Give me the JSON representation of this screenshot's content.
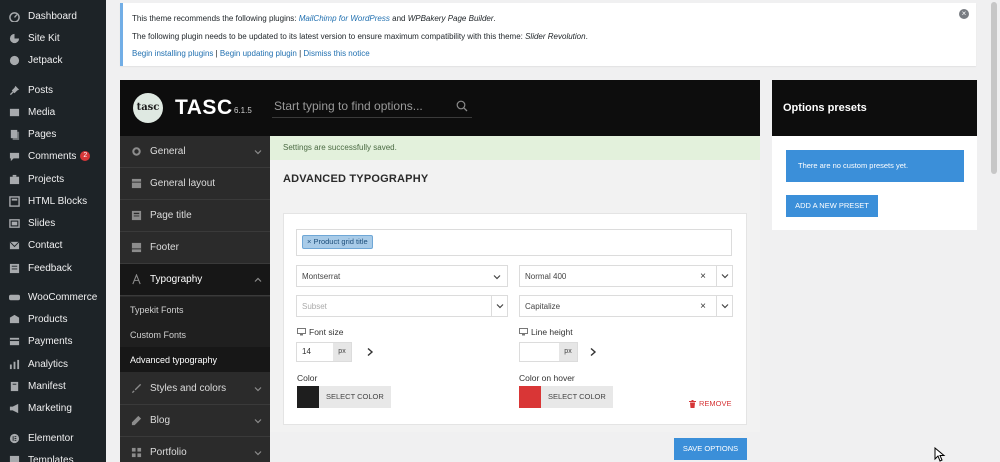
{
  "wp_menu": [
    {
      "label": "Dashboard",
      "icon": "dashboard-icon"
    },
    {
      "label": "Site Kit",
      "icon": "sitekit-icon"
    },
    {
      "label": "Jetpack",
      "icon": "jetpack-icon"
    },
    {
      "label": "Posts",
      "icon": "pin-icon"
    },
    {
      "label": "Media",
      "icon": "media-icon"
    },
    {
      "label": "Pages",
      "icon": "pages-icon"
    },
    {
      "label": "Comments",
      "icon": "comment-icon",
      "badge": "2"
    },
    {
      "label": "Projects",
      "icon": "projects-icon"
    },
    {
      "label": "HTML Blocks",
      "icon": "blocks-icon"
    },
    {
      "label": "Slides",
      "icon": "slides-icon"
    },
    {
      "label": "Contact",
      "icon": "mail-icon"
    },
    {
      "label": "Feedback",
      "icon": "feedback-icon"
    },
    {
      "label": "WooCommerce",
      "icon": "woocommerce-icon"
    },
    {
      "label": "Products",
      "icon": "products-icon"
    },
    {
      "label": "Payments",
      "icon": "payments-icon"
    },
    {
      "label": "Analytics",
      "icon": "analytics-icon"
    },
    {
      "label": "Manifest",
      "icon": "manifest-icon"
    },
    {
      "label": "Marketing",
      "icon": "marketing-icon"
    },
    {
      "label": "Elementor",
      "icon": "elementor-icon"
    },
    {
      "label": "Templates",
      "icon": "templates-icon"
    }
  ],
  "notice": {
    "line1_prefix": "This theme recommends the following plugins: ",
    "line1_plugin1": "MailChimp for WordPress",
    "line1_and": " and ",
    "line1_plugin2": "WPBakery Page Builder",
    "line1_suffix": ".",
    "line2_prefix": "The following plugin needs to be updated to its latest version to ensure maximum compatibility with this theme: ",
    "line2_plugin": "Slider Revolution",
    "line2_suffix": ".",
    "link_install": "Begin installing plugins",
    "link_update": "Begin updating plugin",
    "link_dismiss": "Dismiss this notice",
    "sep": " | ",
    "close": "×"
  },
  "theme": {
    "logo_text": "tasc",
    "brand": "TASC",
    "version": "6.1.5",
    "search_placeholder": "Start typing to find options..."
  },
  "theme_nav": {
    "items_top": [
      {
        "label": "General",
        "icon": "gear-icon"
      },
      {
        "label": "General layout",
        "icon": "layout-icon"
      },
      {
        "label": "Page title",
        "icon": "page-title-icon"
      },
      {
        "label": "Footer",
        "icon": "footer-icon"
      },
      {
        "label": "Typography",
        "icon": "typography-icon"
      }
    ],
    "sub_items": [
      {
        "label": "Typekit Fonts"
      },
      {
        "label": "Custom Fonts"
      },
      {
        "label": "Advanced typography"
      }
    ],
    "items_bottom": [
      {
        "label": "Styles and colors",
        "icon": "brush-icon"
      },
      {
        "label": "Blog",
        "icon": "pencil-icon"
      },
      {
        "label": "Portfolio",
        "icon": "grid-icon"
      }
    ]
  },
  "main": {
    "saved_message": "Settings are successfully saved.",
    "section_title": "ADVANCED TYPOGRAPHY",
    "tag": "× Product grid title",
    "font_family": "Montserrat",
    "font_weight": "Normal 400",
    "subset_placeholder": "Subset",
    "text_transform": "Capitalize",
    "font_size_label": "Font size",
    "font_size_value": "14",
    "font_size_unit": "px",
    "line_height_label": "Line height",
    "line_height_value": "",
    "line_height_unit": "px",
    "color_label": "Color",
    "color_hover_label": "Color on hover",
    "select_color": "SELECT COLOR",
    "color_value": "#1e1e1e",
    "color_hover_value": "#d93636",
    "remove": "REMOVE",
    "clear": "×",
    "save_button": "SAVE OPTIONS"
  },
  "presets": {
    "title": "Options presets",
    "info": "There are no custom presets yet.",
    "add_button": "ADD A NEW PRESET"
  },
  "colors": {
    "accent": "#3b8fd9",
    "wp_sidebar": "#1d2327",
    "theme_dark": "#0d0d0d",
    "danger": "#d63638"
  }
}
